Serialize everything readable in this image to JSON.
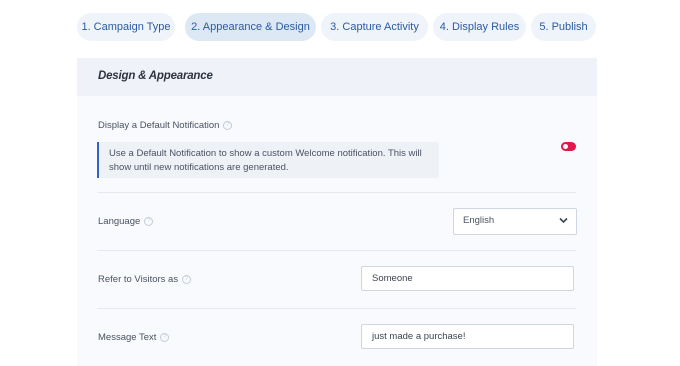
{
  "tabs": [
    {
      "label": "1. Campaign Type",
      "active": false
    },
    {
      "label": "2. Appearance & Design",
      "active": true
    },
    {
      "label": "3. Capture Activity",
      "active": false
    },
    {
      "label": "4. Display Rules",
      "active": false
    },
    {
      "label": "5. Publish",
      "active": false
    }
  ],
  "panel": {
    "title": "Design & Appearance",
    "default_notification": {
      "label": "Display a Default Notification",
      "help_icon": "question-circle-icon",
      "note": "Use a Default Notification to show a custom Welcome notification. This will show until new notifications are generated.",
      "toggle_on": true,
      "toggle_color": "#e3174a"
    },
    "language": {
      "label": "Language",
      "help_icon": "question-circle-icon",
      "selected": "English"
    },
    "visitors": {
      "label": "Refer to Visitors as",
      "help_icon": "question-circle-icon",
      "value": "Someone"
    },
    "message": {
      "label": "Message Text",
      "help_icon": "question-circle-icon",
      "value": "just made a purchase!"
    }
  },
  "colors": {
    "accent": "#2c5aa0",
    "tab_background": "#eff4fa",
    "note_border": "#2f64c4"
  }
}
